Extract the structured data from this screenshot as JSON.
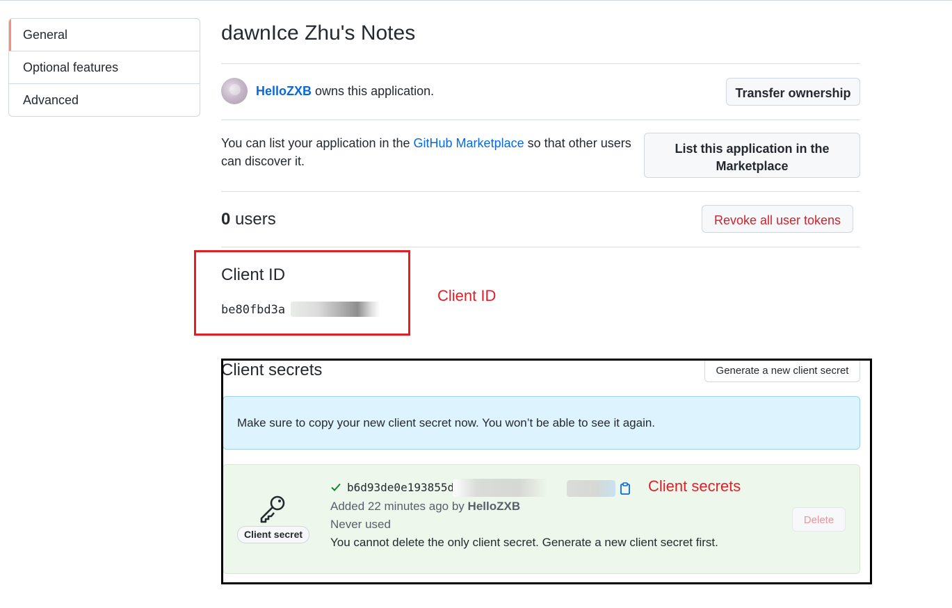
{
  "sidebar": {
    "items": [
      {
        "label": "General",
        "active": true
      },
      {
        "label": "Optional features",
        "active": false
      },
      {
        "label": "Advanced",
        "active": false
      }
    ]
  },
  "app": {
    "title": "dawnIce Zhu's Notes",
    "owner": "HelloZXB",
    "owner_suffix": "owns this application.",
    "transfer_label": "Transfer ownership"
  },
  "marketplace": {
    "text_before": "You can list your application in the",
    "link": "GitHub Marketplace",
    "text_after": "so that other users can discover it.",
    "button_label": "List this application in the Marketplace"
  },
  "users": {
    "count": "0",
    "label": "users",
    "revoke_label": "Revoke all user tokens"
  },
  "client_id": {
    "label": "Client ID",
    "value": "be80fbd3a"
  },
  "client_secrets": {
    "title": "Client secrets",
    "generate_label": "Generate a new client secret",
    "flash": "Make sure to copy your new client secret now. You won’t be able to see it again.",
    "secret": {
      "badge": "Client secret",
      "value": "b6d93de0e193855d",
      "added_prefix": "Added 22 minutes ago by",
      "added_by": "HelloZXB",
      "usage": "Never used",
      "note": "You cannot delete the only client secret. Generate a new client secret first.",
      "delete_label": "Delete"
    }
  },
  "annotations": {
    "client_id": "Client ID",
    "client_secrets": "Client secrets",
    "red": "#e01f27",
    "black": "#000000"
  },
  "colors": {
    "link": "#0969da",
    "danger": "#cf222e",
    "active_indicator": "#fd8c73",
    "flash_bg": "#ddf4ff",
    "card_bg": "#eef7ec"
  },
  "icons": [
    "key-icon",
    "check-icon",
    "copy-icon"
  ]
}
